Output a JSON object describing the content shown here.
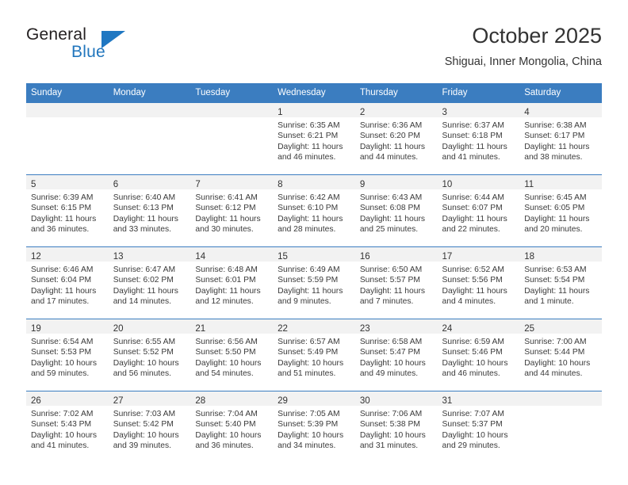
{
  "brand": {
    "name_top": "General",
    "name_bottom": "Blue",
    "color_blue": "#2176bd",
    "color_dark": "#231f20"
  },
  "header": {
    "title": "October 2025",
    "subtitle": "Shiguai, Inner Mongolia, China"
  },
  "calendar": {
    "accent_color": "#3b7dc0",
    "band_color": "#f2f2f2",
    "weekday_headers": [
      "Sunday",
      "Monday",
      "Tuesday",
      "Wednesday",
      "Thursday",
      "Friday",
      "Saturday"
    ],
    "weeks": [
      [
        {
          "day": "",
          "sunrise": "",
          "sunset": "",
          "daylight": ""
        },
        {
          "day": "",
          "sunrise": "",
          "sunset": "",
          "daylight": ""
        },
        {
          "day": "",
          "sunrise": "",
          "sunset": "",
          "daylight": ""
        },
        {
          "day": "1",
          "sunrise": "Sunrise: 6:35 AM",
          "sunset": "Sunset: 6:21 PM",
          "daylight": "Daylight: 11 hours and 46 minutes."
        },
        {
          "day": "2",
          "sunrise": "Sunrise: 6:36 AM",
          "sunset": "Sunset: 6:20 PM",
          "daylight": "Daylight: 11 hours and 44 minutes."
        },
        {
          "day": "3",
          "sunrise": "Sunrise: 6:37 AM",
          "sunset": "Sunset: 6:18 PM",
          "daylight": "Daylight: 11 hours and 41 minutes."
        },
        {
          "day": "4",
          "sunrise": "Sunrise: 6:38 AM",
          "sunset": "Sunset: 6:17 PM",
          "daylight": "Daylight: 11 hours and 38 minutes."
        }
      ],
      [
        {
          "day": "5",
          "sunrise": "Sunrise: 6:39 AM",
          "sunset": "Sunset: 6:15 PM",
          "daylight": "Daylight: 11 hours and 36 minutes."
        },
        {
          "day": "6",
          "sunrise": "Sunrise: 6:40 AM",
          "sunset": "Sunset: 6:13 PM",
          "daylight": "Daylight: 11 hours and 33 minutes."
        },
        {
          "day": "7",
          "sunrise": "Sunrise: 6:41 AM",
          "sunset": "Sunset: 6:12 PM",
          "daylight": "Daylight: 11 hours and 30 minutes."
        },
        {
          "day": "8",
          "sunrise": "Sunrise: 6:42 AM",
          "sunset": "Sunset: 6:10 PM",
          "daylight": "Daylight: 11 hours and 28 minutes."
        },
        {
          "day": "9",
          "sunrise": "Sunrise: 6:43 AM",
          "sunset": "Sunset: 6:08 PM",
          "daylight": "Daylight: 11 hours and 25 minutes."
        },
        {
          "day": "10",
          "sunrise": "Sunrise: 6:44 AM",
          "sunset": "Sunset: 6:07 PM",
          "daylight": "Daylight: 11 hours and 22 minutes."
        },
        {
          "day": "11",
          "sunrise": "Sunrise: 6:45 AM",
          "sunset": "Sunset: 6:05 PM",
          "daylight": "Daylight: 11 hours and 20 minutes."
        }
      ],
      [
        {
          "day": "12",
          "sunrise": "Sunrise: 6:46 AM",
          "sunset": "Sunset: 6:04 PM",
          "daylight": "Daylight: 11 hours and 17 minutes."
        },
        {
          "day": "13",
          "sunrise": "Sunrise: 6:47 AM",
          "sunset": "Sunset: 6:02 PM",
          "daylight": "Daylight: 11 hours and 14 minutes."
        },
        {
          "day": "14",
          "sunrise": "Sunrise: 6:48 AM",
          "sunset": "Sunset: 6:01 PM",
          "daylight": "Daylight: 11 hours and 12 minutes."
        },
        {
          "day": "15",
          "sunrise": "Sunrise: 6:49 AM",
          "sunset": "Sunset: 5:59 PM",
          "daylight": "Daylight: 11 hours and 9 minutes."
        },
        {
          "day": "16",
          "sunrise": "Sunrise: 6:50 AM",
          "sunset": "Sunset: 5:57 PM",
          "daylight": "Daylight: 11 hours and 7 minutes."
        },
        {
          "day": "17",
          "sunrise": "Sunrise: 6:52 AM",
          "sunset": "Sunset: 5:56 PM",
          "daylight": "Daylight: 11 hours and 4 minutes."
        },
        {
          "day": "18",
          "sunrise": "Sunrise: 6:53 AM",
          "sunset": "Sunset: 5:54 PM",
          "daylight": "Daylight: 11 hours and 1 minute."
        }
      ],
      [
        {
          "day": "19",
          "sunrise": "Sunrise: 6:54 AM",
          "sunset": "Sunset: 5:53 PM",
          "daylight": "Daylight: 10 hours and 59 minutes."
        },
        {
          "day": "20",
          "sunrise": "Sunrise: 6:55 AM",
          "sunset": "Sunset: 5:52 PM",
          "daylight": "Daylight: 10 hours and 56 minutes."
        },
        {
          "day": "21",
          "sunrise": "Sunrise: 6:56 AM",
          "sunset": "Sunset: 5:50 PM",
          "daylight": "Daylight: 10 hours and 54 minutes."
        },
        {
          "day": "22",
          "sunrise": "Sunrise: 6:57 AM",
          "sunset": "Sunset: 5:49 PM",
          "daylight": "Daylight: 10 hours and 51 minutes."
        },
        {
          "day": "23",
          "sunrise": "Sunrise: 6:58 AM",
          "sunset": "Sunset: 5:47 PM",
          "daylight": "Daylight: 10 hours and 49 minutes."
        },
        {
          "day": "24",
          "sunrise": "Sunrise: 6:59 AM",
          "sunset": "Sunset: 5:46 PM",
          "daylight": "Daylight: 10 hours and 46 minutes."
        },
        {
          "day": "25",
          "sunrise": "Sunrise: 7:00 AM",
          "sunset": "Sunset: 5:44 PM",
          "daylight": "Daylight: 10 hours and 44 minutes."
        }
      ],
      [
        {
          "day": "26",
          "sunrise": "Sunrise: 7:02 AM",
          "sunset": "Sunset: 5:43 PM",
          "daylight": "Daylight: 10 hours and 41 minutes."
        },
        {
          "day": "27",
          "sunrise": "Sunrise: 7:03 AM",
          "sunset": "Sunset: 5:42 PM",
          "daylight": "Daylight: 10 hours and 39 minutes."
        },
        {
          "day": "28",
          "sunrise": "Sunrise: 7:04 AM",
          "sunset": "Sunset: 5:40 PM",
          "daylight": "Daylight: 10 hours and 36 minutes."
        },
        {
          "day": "29",
          "sunrise": "Sunrise: 7:05 AM",
          "sunset": "Sunset: 5:39 PM",
          "daylight": "Daylight: 10 hours and 34 minutes."
        },
        {
          "day": "30",
          "sunrise": "Sunrise: 7:06 AM",
          "sunset": "Sunset: 5:38 PM",
          "daylight": "Daylight: 10 hours and 31 minutes."
        },
        {
          "day": "31",
          "sunrise": "Sunrise: 7:07 AM",
          "sunset": "Sunset: 5:37 PM",
          "daylight": "Daylight: 10 hours and 29 minutes."
        },
        {
          "day": "",
          "sunrise": "",
          "sunset": "",
          "daylight": ""
        }
      ]
    ]
  }
}
